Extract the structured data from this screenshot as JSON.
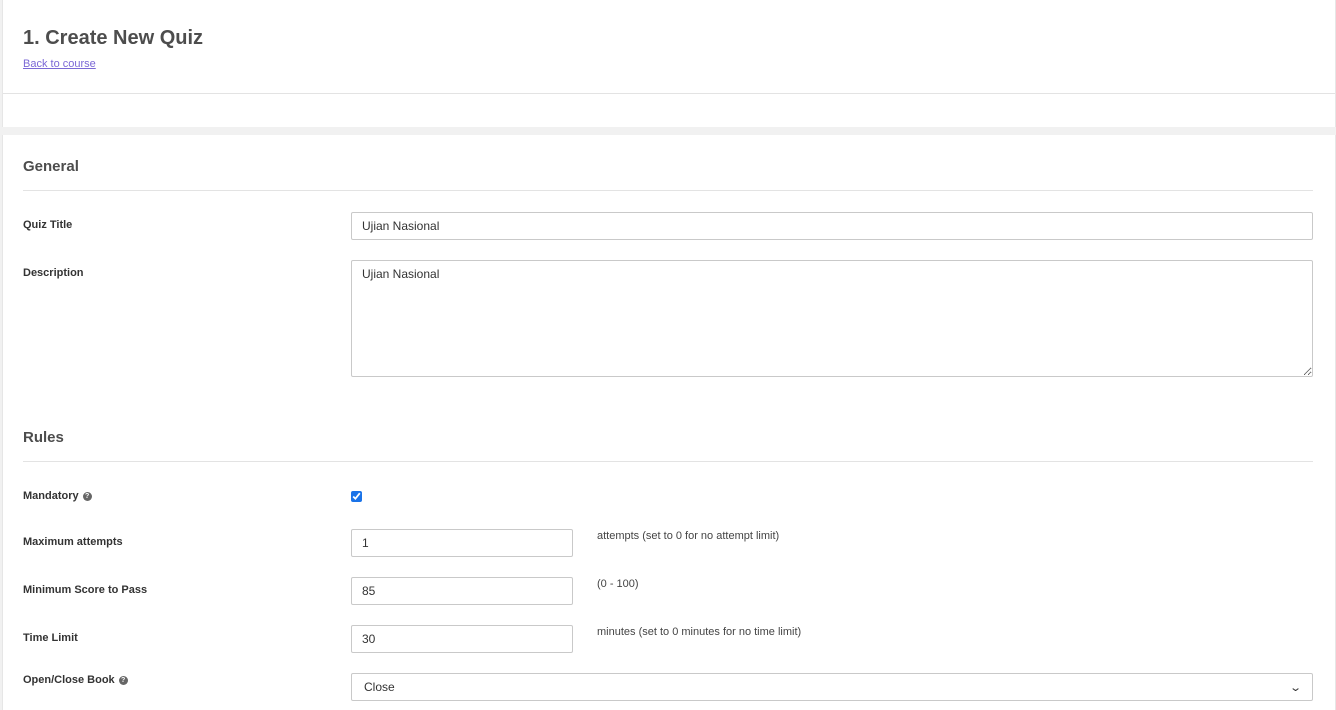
{
  "header": {
    "title": "1. Create New Quiz",
    "back_link": "Back to course"
  },
  "general": {
    "section_title": "General",
    "quiz_title_label": "Quiz Title",
    "quiz_title_value": "Ujian Nasional",
    "description_label": "Description",
    "description_value": "Ujian Nasional"
  },
  "rules": {
    "section_title": "Rules",
    "mandatory_label": "Mandatory",
    "mandatory_checked": true,
    "max_attempts_label": "Maximum attempts",
    "max_attempts_value": "1",
    "max_attempts_hint": "attempts (set to 0 for no attempt limit)",
    "min_score_label": "Minimum Score to Pass",
    "min_score_value": "85",
    "min_score_hint": "(0 - 100)",
    "time_limit_label": "Time Limit",
    "time_limit_value": "30",
    "time_limit_hint": "minutes (set to 0 minutes for no time limit)",
    "open_close_label": "Open/Close Book",
    "open_close_value": "Close"
  },
  "icons": {
    "help": "help-circle-icon",
    "chevron": "chevron-down-icon"
  },
  "colors": {
    "link": "#7b68d6",
    "checkbox": "#1a73e8"
  }
}
